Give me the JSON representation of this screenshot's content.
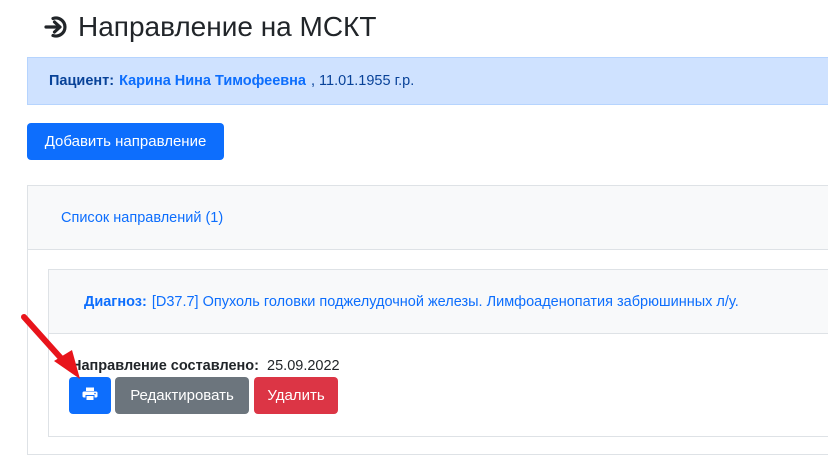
{
  "page": {
    "title": "Направление на МСКТ",
    "title_icon": "sign-in-icon"
  },
  "patient": {
    "label": "Пациент:",
    "name": "Карина Нина Тимофеевна",
    "dob": ", 11.01.1955 г.р."
  },
  "actions": {
    "add_referral": "Добавить направление"
  },
  "referrals": {
    "header": "Список направлений (1)",
    "items": [
      {
        "diagnosis_label": "Диагноз:",
        "diagnosis_text": "[D37.7] Опухоль головки поджелудочной железы. Лимфоаденопатия забрюшинных л/у.",
        "compiled_label": "Направление составлено:",
        "compiled_date": "25.09.2022",
        "print_icon": "printer-icon",
        "edit_label": "Редактировать",
        "delete_label": "Удалить"
      }
    ]
  },
  "annotation": {
    "arrow_icon": "red-arrow-icon",
    "arrow_color": "#e8141b"
  },
  "colors": {
    "primary": "#0d6efd",
    "secondary": "#6c757d",
    "danger": "#dc3545",
    "info_bg": "#cfe2ff"
  }
}
